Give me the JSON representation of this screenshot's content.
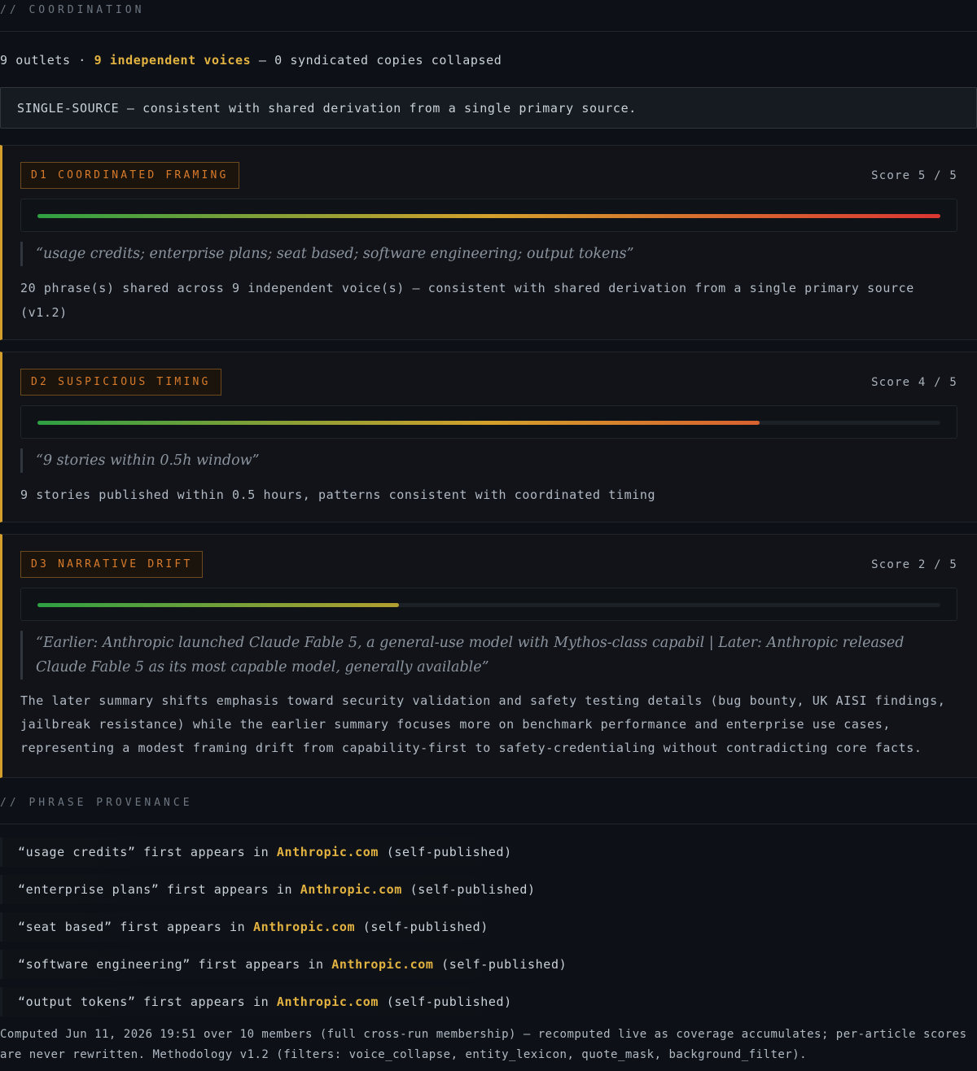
{
  "coordination": {
    "section_label": "// COORDINATION",
    "outlets_text": "9 outlets ·",
    "voices_text": "9 independent voices",
    "collapsed_text": "— 0 syndicated copies collapsed",
    "verdict": "SINGLE-SOURCE — consistent with shared derivation from a single primary source."
  },
  "cards": [
    {
      "tag": "D1 COORDINATED FRAMING",
      "score_label": "Score 5 / 5",
      "score": 5,
      "score_max": 5,
      "quote": "“usage credits; enterprise plans; seat based; software engineering; output tokens”",
      "explanation": "20 phrase(s) shared across 9 independent voice(s) — consistent with shared derivation from a single primary source (v1.2)"
    },
    {
      "tag": "D2 SUSPICIOUS TIMING",
      "score_label": "Score 4 / 5",
      "score": 4,
      "score_max": 5,
      "quote": "“9 stories within 0.5h window”",
      "explanation": "9 stories published within 0.5 hours, patterns consistent with coordinated timing"
    },
    {
      "tag": "D3 NARRATIVE DRIFT",
      "score_label": "Score 2 / 5",
      "score": 2,
      "score_max": 5,
      "quote": "“Earlier: Anthropic launched Claude Fable 5, a general-use model with Mythos-class capabil | Later: Anthropic released Claude Fable 5 as its most capable model, generally available”",
      "explanation": "The later summary shifts emphasis toward security validation and safety testing details (bug bounty, UK AISI findings, jailbreak resistance) while the earlier summary focuses more on benchmark performance and enterprise use cases, representing a modest framing drift from capability-first to safety-credentialing without contradicting core facts."
    }
  ],
  "provenance": {
    "section_label": "// PHRASE PROVENANCE",
    "items": [
      {
        "phrase": "“usage credits”",
        "mid": "first appears in",
        "source": "Anthropic.com",
        "note": "(self-published)"
      },
      {
        "phrase": "“enterprise plans”",
        "mid": "first appears in",
        "source": "Anthropic.com",
        "note": "(self-published)"
      },
      {
        "phrase": "“seat based”",
        "mid": "first appears in",
        "source": "Anthropic.com",
        "note": "(self-published)"
      },
      {
        "phrase": "“software engineering”",
        "mid": "first appears in",
        "source": "Anthropic.com",
        "note": "(self-published)"
      },
      {
        "phrase": "“output tokens”",
        "mid": "first appears in",
        "source": "Anthropic.com",
        "note": "(self-published)"
      }
    ]
  },
  "footer": "Computed Jun 11, 2026 19:51 over 10 members (full cross-run membership) — recomputed live as coverage accumulates; per-article scores are never rewritten. Methodology v1.2 (filters: voice_collapse, entity_lexicon, quote_mask, background_filter).",
  "colors": {
    "accent_gold": "#e3b341",
    "card_border": "#d4a02b",
    "tag_text": "#d97b2b",
    "bar_low": "#2ea043",
    "bar_high": "#da3633"
  }
}
